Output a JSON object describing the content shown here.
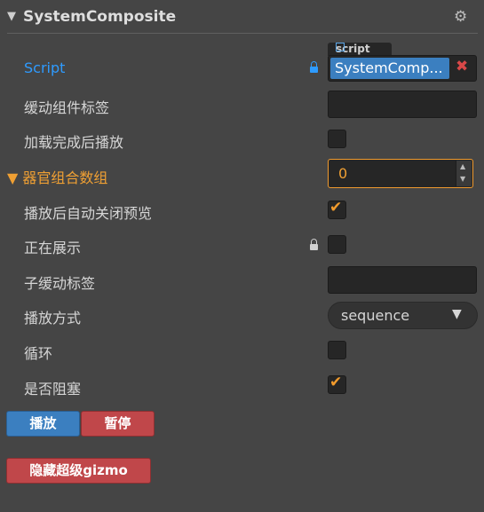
{
  "header": {
    "title": "SystemComposite"
  },
  "script": {
    "label": "Script",
    "tag": "script",
    "value": "SystemComp..."
  },
  "fields": {
    "anim_label": "缓动组件标签",
    "play_after_load": "加载完成后播放",
    "organ_group": "器官组合数组",
    "organ_group_value": "0",
    "auto_close_preview": "播放后自动关闭预览",
    "showing": "正在展示",
    "sub_anim_label": "子缓动标签",
    "play_mode": "播放方式",
    "play_mode_value": "sequence",
    "loop": "循环",
    "blocking": "是否阻塞"
  },
  "checks": {
    "play_after_load": false,
    "auto_close_preview": true,
    "showing": false,
    "loop": false,
    "blocking": true
  },
  "buttons": {
    "play": "播放",
    "pause": "暂停",
    "hide_gizmo": "隐藏超级gizmo"
  },
  "colors": {
    "accent_blue": "#2e9bff",
    "accent_orange": "#f0a033",
    "check_orange": "#f29b2c",
    "button_blue": "#3b7fc0",
    "button_red": "#c0474a"
  },
  "icons": {
    "collapse": "triangle-down-icon",
    "settings": "gear-icon",
    "lock": "lock-icon",
    "external": "external-link-icon",
    "remove": "close-icon",
    "check": "checkmark-icon"
  }
}
